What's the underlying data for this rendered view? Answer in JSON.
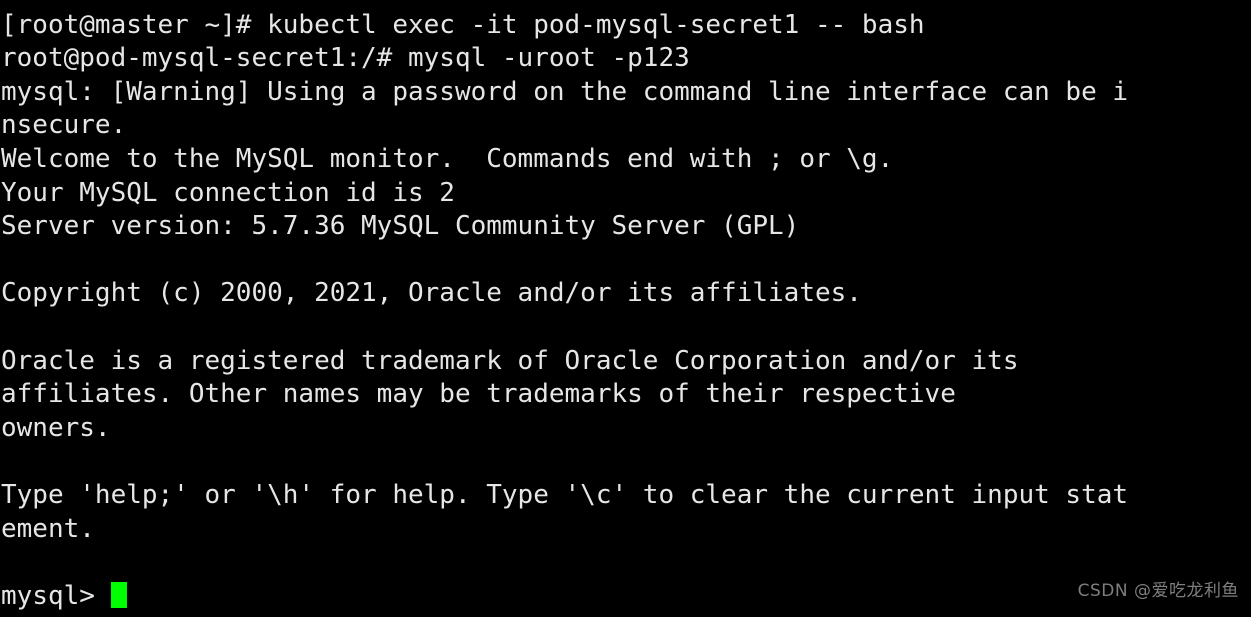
{
  "terminal": {
    "background_color": "#000000",
    "foreground_color": "#e6e6e6",
    "cursor_color": "#00ff00",
    "lines": [
      {
        "id": "line-clipped-top",
        "text": " "
      },
      {
        "id": "line-kubectl-exec",
        "text": "[root@master ~]# kubectl exec -it pod-mysql-secret1 -- bash"
      },
      {
        "id": "line-mysql-login",
        "text": "root@pod-mysql-secret1:/# mysql -uroot -p123"
      },
      {
        "id": "line-warning-1",
        "text": "mysql: [Warning] Using a password on the command line interface can be i"
      },
      {
        "id": "line-warning-2",
        "text": "nsecure."
      },
      {
        "id": "line-welcome",
        "text": "Welcome to the MySQL monitor.  Commands end with ; or \\g."
      },
      {
        "id": "line-connection-id",
        "text": "Your MySQL connection id is 2"
      },
      {
        "id": "line-server-version",
        "text": "Server version: 5.7.36 MySQL Community Server (GPL)"
      },
      {
        "id": "line-blank-1",
        "text": ""
      },
      {
        "id": "line-copyright",
        "text": "Copyright (c) 2000, 2021, Oracle and/or its affiliates."
      },
      {
        "id": "line-blank-2",
        "text": ""
      },
      {
        "id": "line-trademark-1",
        "text": "Oracle is a registered trademark of Oracle Corporation and/or its"
      },
      {
        "id": "line-trademark-2",
        "text": "affiliates. Other names may be trademarks of their respective"
      },
      {
        "id": "line-trademark-3",
        "text": "owners."
      },
      {
        "id": "line-blank-3",
        "text": ""
      },
      {
        "id": "line-help-1",
        "text": "Type 'help;' or '\\h' for help. Type '\\c' to clear the current input stat"
      },
      {
        "id": "line-help-2",
        "text": "ement."
      },
      {
        "id": "line-blank-4",
        "text": ""
      }
    ],
    "prompt": {
      "text": "mysql> ",
      "cursor_visible": true
    }
  },
  "watermark": {
    "text": "CSDN @爱吃龙利鱼",
    "color": "#9a9a9a"
  }
}
